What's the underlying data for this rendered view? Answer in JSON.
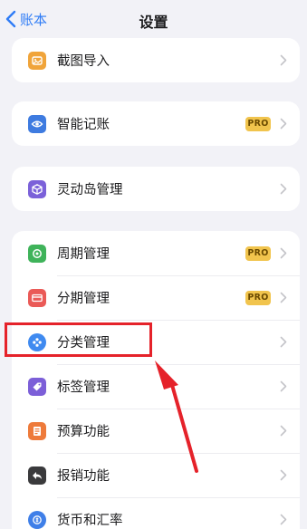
{
  "nav": {
    "back_label": "账本",
    "title": "设置"
  },
  "pro_badge": "PRO",
  "colors": {
    "accent": "#2f7cf6",
    "annotation": "#e5222a",
    "pro": "#f1c44d"
  },
  "groups": [
    {
      "items": [
        {
          "label": "截图导入",
          "icon": "screenshot-import-icon",
          "color": "#f0a43a",
          "pro": false
        }
      ]
    },
    {
      "items": [
        {
          "label": "智能记账",
          "icon": "eye-icon",
          "color": "#3e7be0",
          "pro": true
        }
      ]
    },
    {
      "items": [
        {
          "label": "灵动岛管理",
          "icon": "cube-icon",
          "color": "#7b61d9",
          "pro": false
        }
      ]
    },
    {
      "items": [
        {
          "label": "周期管理",
          "icon": "cycle-icon",
          "color": "#3fb35a",
          "pro": true
        },
        {
          "label": "分期管理",
          "icon": "card-icon",
          "color": "#ea5a57",
          "pro": true
        },
        {
          "label": "分类管理",
          "icon": "category-icon",
          "color": "#3f8af0",
          "pro": false
        },
        {
          "label": "标签管理",
          "icon": "tag-icon",
          "color": "#7c5fd8",
          "pro": false
        },
        {
          "label": "预算功能",
          "icon": "budget-icon",
          "color": "#ee7a3a",
          "pro": false
        },
        {
          "label": "报销功能",
          "icon": "reimburse-icon",
          "color": "#3a3a3c",
          "pro": false
        },
        {
          "label": "货币和汇率",
          "icon": "currency-icon",
          "color": "#3f7fe8",
          "pro": false
        }
      ]
    }
  ]
}
